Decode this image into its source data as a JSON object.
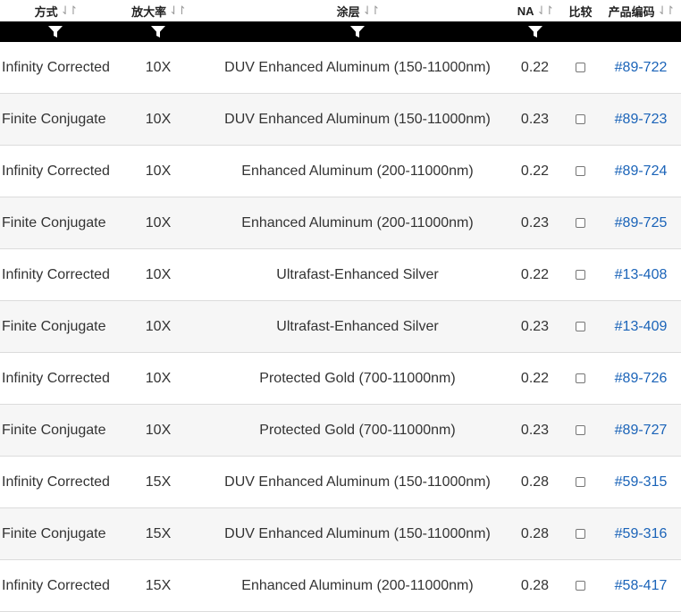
{
  "headers": {
    "method": "方式",
    "magnification": "放大率",
    "coating": "涂层",
    "na": "NA",
    "compare": "比较",
    "sku": "产品编码",
    "sort_glyph": "⇃↾"
  },
  "filter_icon": "funnel-icon",
  "rows": [
    {
      "method": "Infinity Corrected",
      "mag": "10X",
      "coating": "DUV Enhanced Aluminum (150-11000nm)",
      "na": "0.22",
      "sku": "#89-722"
    },
    {
      "method": "Finite Conjugate",
      "mag": "10X",
      "coating": "DUV Enhanced Aluminum (150-11000nm)",
      "na": "0.23",
      "sku": "#89-723"
    },
    {
      "method": "Infinity Corrected",
      "mag": "10X",
      "coating": "Enhanced Aluminum (200-11000nm)",
      "na": "0.22",
      "sku": "#89-724"
    },
    {
      "method": "Finite Conjugate",
      "mag": "10X",
      "coating": "Enhanced Aluminum (200-11000nm)",
      "na": "0.23",
      "sku": "#89-725"
    },
    {
      "method": "Infinity Corrected",
      "mag": "10X",
      "coating": "Ultrafast-Enhanced Silver",
      "na": "0.22",
      "sku": "#13-408"
    },
    {
      "method": "Finite Conjugate",
      "mag": "10X",
      "coating": "Ultrafast-Enhanced Silver",
      "na": "0.23",
      "sku": "#13-409"
    },
    {
      "method": "Infinity Corrected",
      "mag": "10X",
      "coating": "Protected Gold (700-11000nm)",
      "na": "0.22",
      "sku": "#89-726"
    },
    {
      "method": "Finite Conjugate",
      "mag": "10X",
      "coating": "Protected Gold (700-11000nm)",
      "na": "0.23",
      "sku": "#89-727"
    },
    {
      "method": "Infinity Corrected",
      "mag": "15X",
      "coating": "DUV Enhanced Aluminum (150-11000nm)",
      "na": "0.28",
      "sku": "#59-315"
    },
    {
      "method": "Finite Conjugate",
      "mag": "15X",
      "coating": "DUV Enhanced Aluminum (150-11000nm)",
      "na": "0.28",
      "sku": "#59-316"
    },
    {
      "method": "Infinity Corrected",
      "mag": "15X",
      "coating": "Enhanced Aluminum (200-11000nm)",
      "na": "0.28",
      "sku": "#58-417"
    }
  ],
  "colors": {
    "link": "#1a63b8",
    "filter_bar": "#000000",
    "row_alt": "#f6f6f6",
    "row_border": "#dcdcdc"
  }
}
